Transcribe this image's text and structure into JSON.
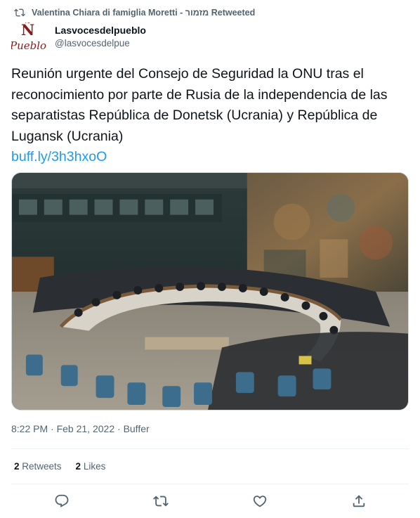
{
  "retweet_banner": {
    "text": "Valentina Chiara di famiglia Moretti - מזמור Retweeted"
  },
  "author": {
    "avatar_letter": "Ñ",
    "avatar_word": "Pueblo",
    "display_name": "Lasvocesdelpueblo",
    "handle": "@lasvocesdelpue"
  },
  "tweet": {
    "text": "Reunión urgente del Consejo de Seguridad la ONU tras el reconocimiento por parte de Rusia de la independencia de las separatistas República de Donetsk (Ucrania) y República de Lugansk (Ucrania)",
    "link": "buff.ly/3h3hxoO"
  },
  "meta": {
    "time": "8:22 PM",
    "date": "Feb 21, 2022",
    "source": "Buffer",
    "separator": " · "
  },
  "stats": {
    "retweets_count": "2",
    "retweets_label": " Retweets",
    "likes_count": "2",
    "likes_label": " Likes"
  },
  "icons": [
    "retweet-icon",
    "reply-icon",
    "like-icon",
    "share-icon"
  ],
  "colors": {
    "link": "#1d9bf0",
    "secondary": "#536471",
    "primary": "#0f1419"
  }
}
